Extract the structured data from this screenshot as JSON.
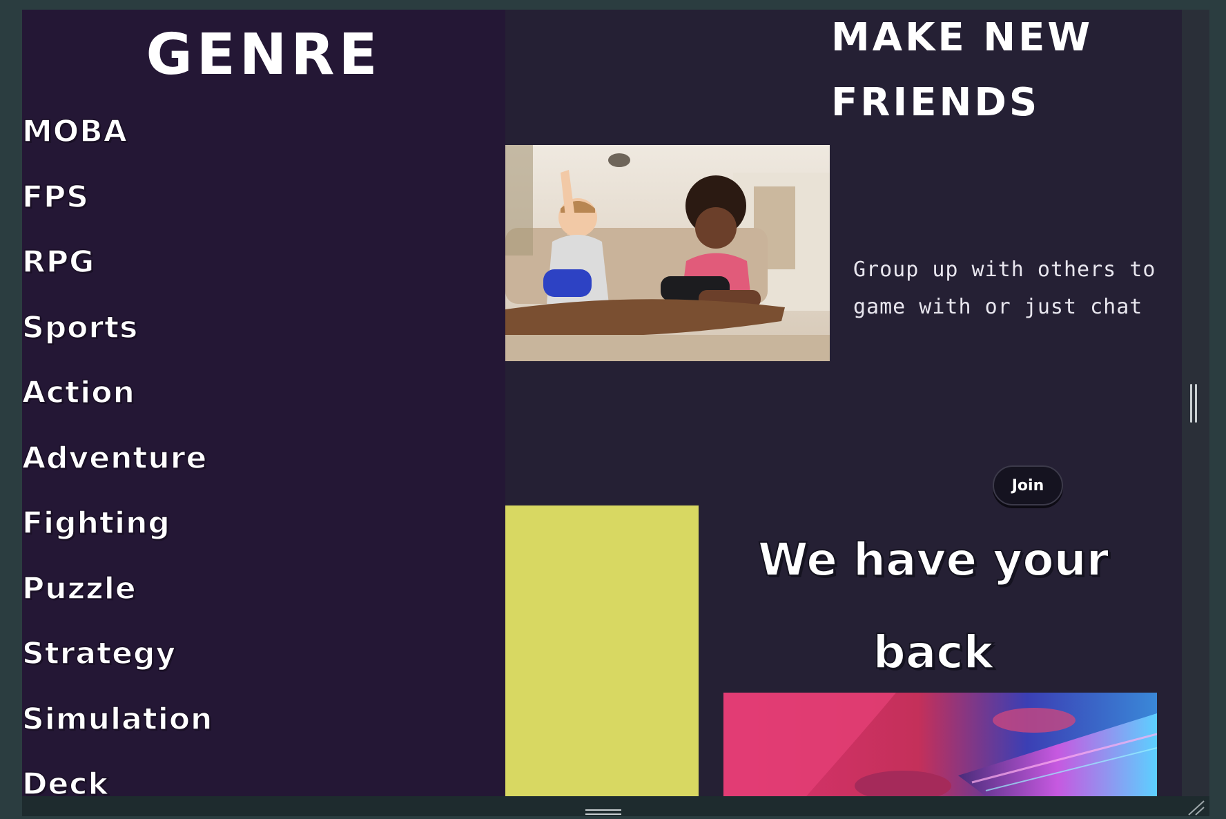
{
  "genre": {
    "title": "GENRE",
    "items": [
      {
        "label": "MOBA"
      },
      {
        "label": "FPS"
      },
      {
        "label": "RPG"
      },
      {
        "label": "Sports"
      },
      {
        "label": "Action"
      },
      {
        "label": "Adventure"
      },
      {
        "label": "Fighting"
      },
      {
        "label": "Puzzle"
      },
      {
        "label": "Strategy"
      },
      {
        "label": "Simulation"
      },
      {
        "label": "Deck"
      }
    ]
  },
  "friends": {
    "title_line1": "MAKE NEW",
    "title_line2": "FRIENDS",
    "description": "Group up with others to game with or just chat",
    "join_label": "Join"
  },
  "back": {
    "title_line1": "We have your",
    "title_line2": "back"
  },
  "colors": {
    "page_bg": "#252034",
    "genre_bg": "#241735",
    "accent_yellow": "#d8d862",
    "frame": "#2b3d40"
  },
  "icons": {
    "bottom_handle": "drag-handle-icon",
    "corner": "resize-grip-icon",
    "side": "side-panel-handle-icon"
  }
}
